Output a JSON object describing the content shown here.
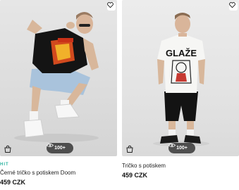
{
  "products": [
    {
      "badge": "HIT",
      "title": "Černé tričko s potiskem Doom",
      "price": "459 CZK",
      "views": "100+",
      "icons": {
        "wishlist": "heart-icon",
        "cart": "bag-icon",
        "views": "eye-icon"
      }
    },
    {
      "badge": "",
      "title": "Tričko s potiskem",
      "price": "459 CZK",
      "views": "100+",
      "print_text": "GLAŽE",
      "icons": {
        "wishlist": "heart-icon",
        "cart": "bag-icon",
        "views": "eye-icon"
      }
    }
  ],
  "colors": {
    "badge": "#2bb3a0",
    "views_pill": "#282828"
  }
}
